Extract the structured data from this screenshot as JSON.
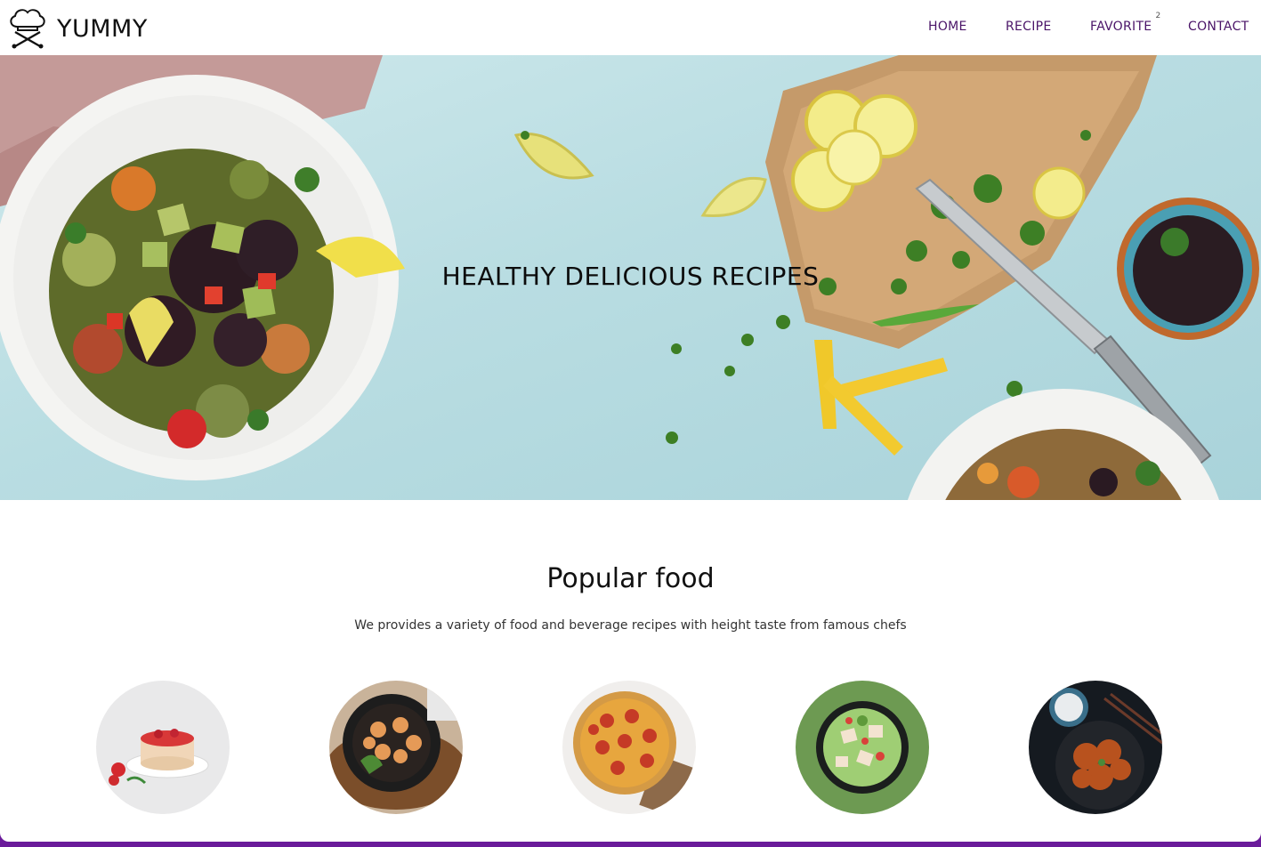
{
  "header": {
    "brand": "YUMMY",
    "logo_icon": "chef-hat-utensils-icon",
    "nav": [
      {
        "label": "HOME"
      },
      {
        "label": "RECIPE"
      },
      {
        "label": "FAVORITE",
        "badge": "2"
      },
      {
        "label": "CONTACT"
      }
    ]
  },
  "hero": {
    "title": "HEALTHY DELICIOUS RECIPES"
  },
  "popular": {
    "title": "Popular food",
    "subtitle": "We provides a variety of food and beverage recipes with height taste from famous chefs",
    "items": [
      {
        "image": "strawberry-cheesecake"
      },
      {
        "image": "shrimp-skillet"
      },
      {
        "image": "pepperoni-pizza"
      },
      {
        "image": "salad-bowl"
      },
      {
        "image": "glazed-chicken-wings"
      }
    ]
  },
  "colors": {
    "nav_text": "#4a1468",
    "frame": "#6a1b9a"
  }
}
